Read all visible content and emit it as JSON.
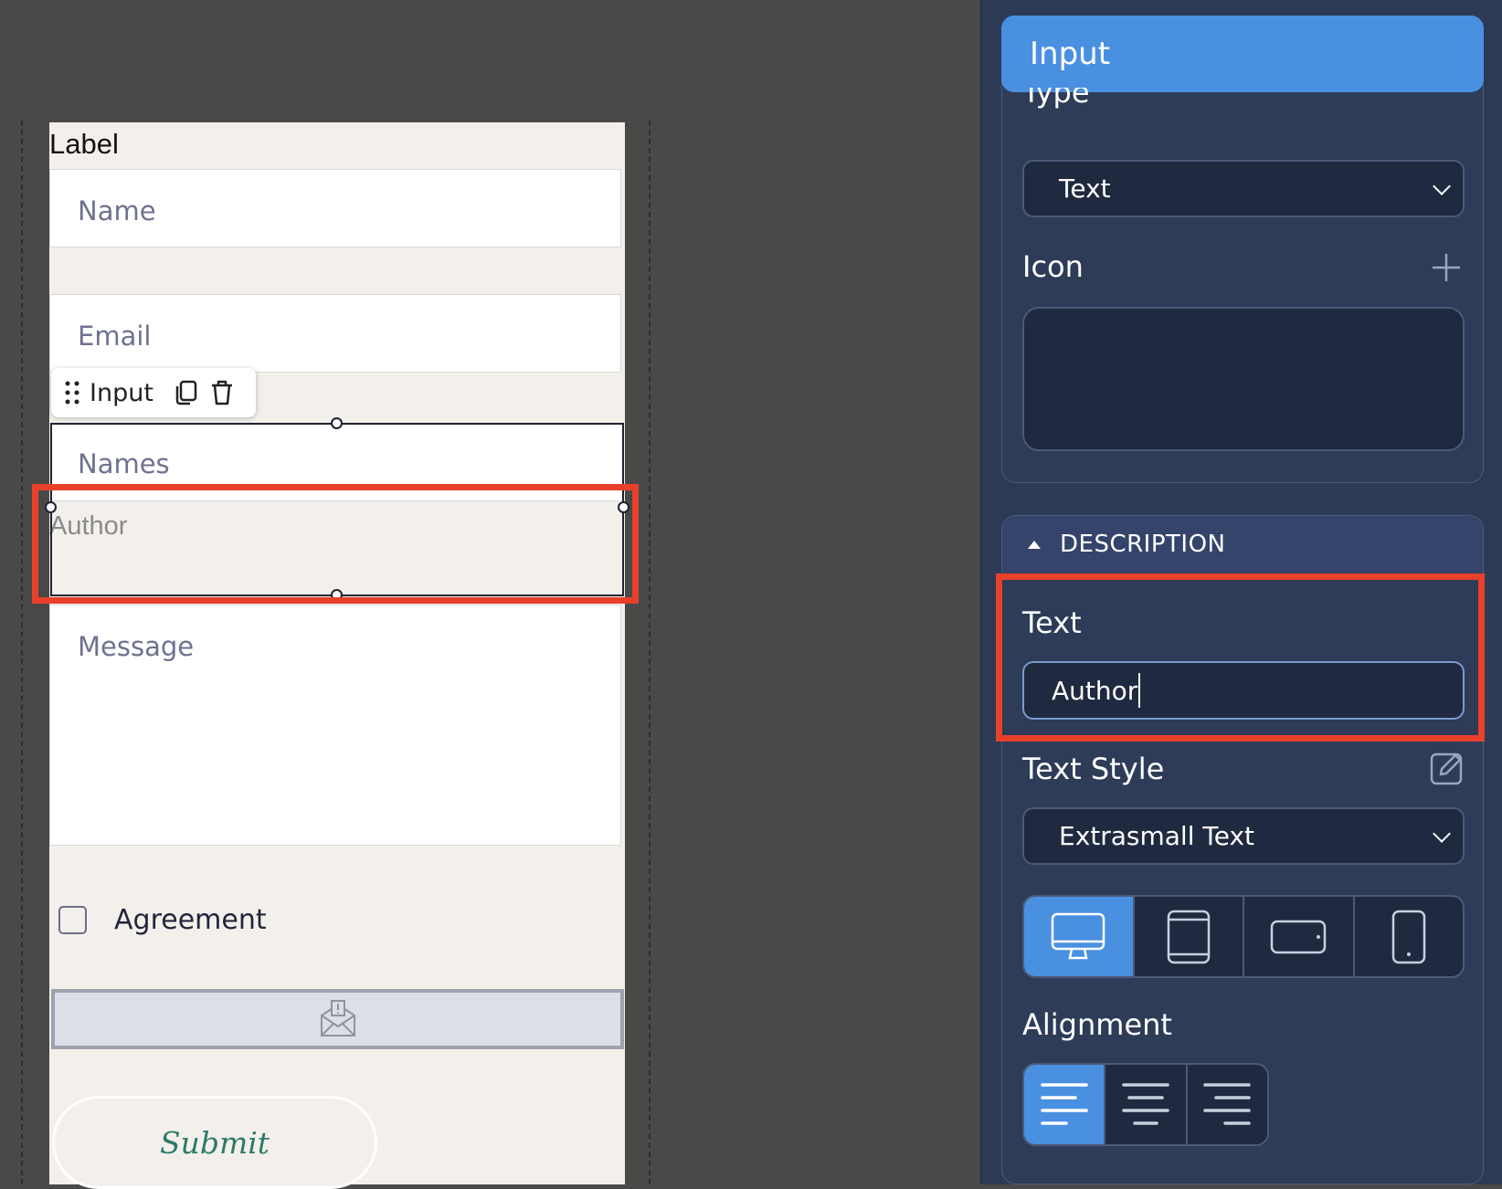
{
  "form": {
    "label": "Label",
    "fields": {
      "name_placeholder": "Name",
      "email_placeholder": "Email",
      "names_placeholder": "Names",
      "author_placeholder": "Author",
      "message_placeholder": "Message"
    },
    "toolbar": {
      "label": "Input"
    },
    "agreement_label": "Agreement",
    "submit_label": "Submit"
  },
  "panel": {
    "header_title": "Input",
    "type_label": "Type",
    "type_value": "Text",
    "icon_label": "Icon",
    "description_section": "DESCRIPTION",
    "text_label": "Text",
    "text_value": "Author",
    "text_style_label": "Text Style",
    "text_style_value": "Extrasmall Text",
    "alignment_label": "Alignment",
    "devices": [
      "desktop-icon",
      "tablet-icon",
      "tablet-landscape-icon",
      "phone-icon"
    ],
    "active_device": "desktop",
    "active_alignment": "left"
  },
  "colors": {
    "accent": "#4a90e0",
    "highlight": "#e8402a",
    "panel_bg": "#2c3a55",
    "canvas_bg": "#4a4948"
  }
}
